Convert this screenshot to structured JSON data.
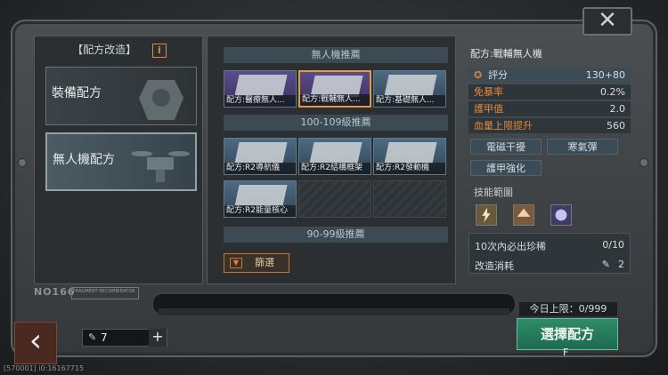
{
  "left": {
    "title": "【配方改造】",
    "info_icon": "i",
    "tabs": [
      {
        "label": "裝備配方"
      },
      {
        "label": "無人機配方"
      }
    ],
    "stamp": "NO166",
    "stamp_small": "FRAGMENT RECOMBINATOR"
  },
  "mid": {
    "sections": [
      {
        "title": "無人機推薦"
      },
      {
        "title": "100-109級推薦"
      },
      {
        "title": "90-99級推薦"
      }
    ],
    "drone_cards": [
      {
        "label": "配方:醫療無人..."
      },
      {
        "label": "配方:戰輔無人..."
      },
      {
        "label": "配方:基礎無人..."
      }
    ],
    "level_cards": [
      {
        "label": "配方:R2導航儀"
      },
      {
        "label": "配方:R2結構框架"
      },
      {
        "label": "配方:R2發動機"
      },
      {
        "label": "配方:R2能量核心"
      }
    ],
    "filter_label": "篩選"
  },
  "right": {
    "title": "配方:戰輔無人機",
    "stats": [
      {
        "key": "評分",
        "value": "130+80"
      },
      {
        "key": "免暴率",
        "value": "0.2%"
      },
      {
        "key": "護甲值",
        "value": "2.0"
      },
      {
        "key": "血量上限提升",
        "value": "560"
      }
    ],
    "tags": [
      "電磁干擾",
      "寒氣彈",
      "護甲強化"
    ],
    "skill_title": "技能範圍",
    "info_rows": [
      {
        "key": "10次內必出珍稀",
        "value": "0/10"
      },
      {
        "key": "改造消耗",
        "value": "2"
      }
    ]
  },
  "bottom": {
    "limit": "今日上限：0/999",
    "qty": "7",
    "choose_label": "選擇配方",
    "choose_key": "F",
    "uid": "[570001] i0:16167715"
  }
}
